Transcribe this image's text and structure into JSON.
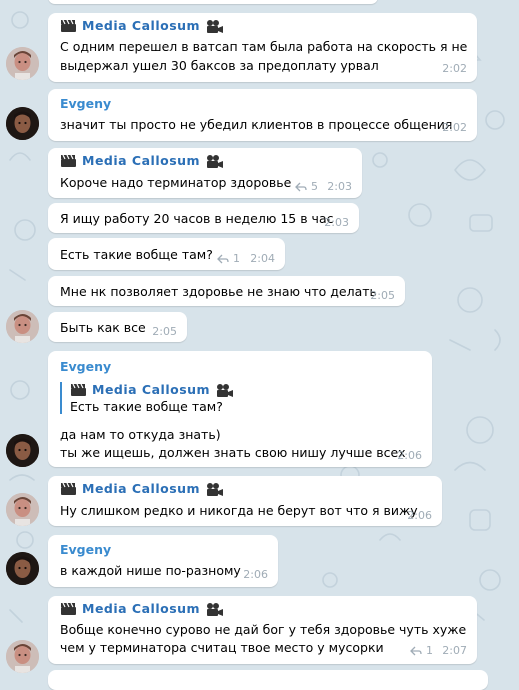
{
  "chat": {
    "sender_media": "Media Callosum",
    "sender_evgeny": "Evgeny",
    "messages": [
      {
        "text1": "С одним перешел в ватсап там была работа на скорость я не",
        "text2": "выдержал ушел 30 баксов за предоплату урвал",
        "time": "2:02"
      },
      {
        "text1": "значит ты просто не убедил клиентов в процессе общения",
        "time": "2:02"
      },
      {
        "text1": "Короче надо терминатор здоровье",
        "replies": "5",
        "time": "2:03"
      },
      {
        "text1": "Я ищу работу 20 часов в неделю 15 в час",
        "time": "2:03"
      },
      {
        "text1": "Есть такие вобще там?",
        "replies": "1",
        "time": "2:04"
      },
      {
        "text1": "Мне нк позволяет здоровье не знаю что делать",
        "time": "2:05"
      },
      {
        "text1": "Быть как все",
        "time": "2:05"
      },
      {
        "quote": "Есть такие вобще там?",
        "text1": "да нам то откуда знать)",
        "text2": "ты же ищешь, должен знать свою нишу лучше всех",
        "time": "2:06"
      },
      {
        "text1": "Ну слишком редко и никогда не берут вот что я вижу",
        "time": "2:06"
      },
      {
        "text1": "в каждой нише по-разному",
        "time": "2:06"
      },
      {
        "text1": "Вобще конечно сурово не дай бог у тебя здоровье чуть хуже",
        "text2": "чем у терминатора считац твое место у мусорки",
        "replies": "1",
        "time": "2:07"
      }
    ]
  }
}
